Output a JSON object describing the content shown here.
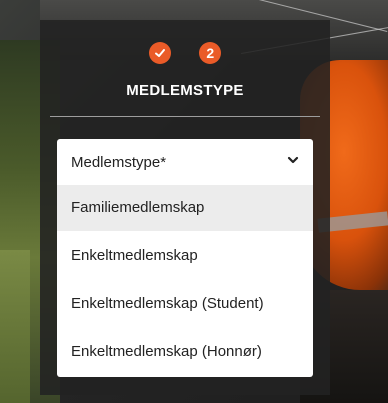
{
  "steps": [
    {
      "state": "done",
      "icon": "check-icon",
      "label": ""
    },
    {
      "state": "current",
      "label": "2"
    }
  ],
  "accent_color": "#ea5b28",
  "section_title": "MEDLEMSTYPE",
  "dropdown": {
    "label": "Medlemstype*",
    "options": [
      {
        "label": "Familiemedlemskap",
        "highlighted": true
      },
      {
        "label": "Enkeltmedlemskap",
        "highlighted": false
      },
      {
        "label": "Enkeltmedlemskap (Student)",
        "highlighted": false
      },
      {
        "label": "Enkeltmedlemskap (Honnør)",
        "highlighted": false
      }
    ]
  }
}
